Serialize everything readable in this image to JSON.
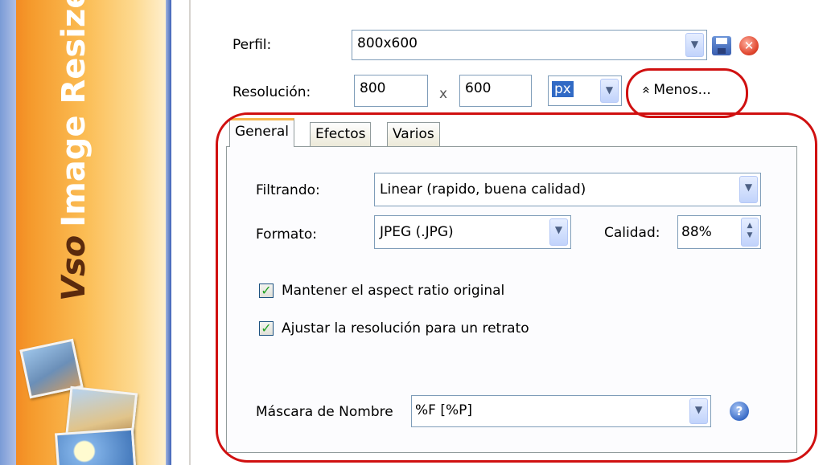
{
  "banner": {
    "logo_text": "Vso",
    "title": "Image Resizer"
  },
  "profile": {
    "label": "Perfil:",
    "value": "800x600",
    "save_icon": "save-icon",
    "delete_icon": "delete-icon",
    "delete_glyph": "✕"
  },
  "resolution": {
    "label": "Resolución:",
    "width": "800",
    "separator": "x",
    "height": "600",
    "unit": "px"
  },
  "less_button": {
    "icon": "«",
    "label": "Menos..."
  },
  "tabs": [
    {
      "label": "General",
      "active": true
    },
    {
      "label": "Efectos",
      "active": false
    },
    {
      "label": "Varios",
      "active": false
    }
  ],
  "general": {
    "filter_label": "Filtrando:",
    "filter_value": "Linear  (rapido, buena calidad)",
    "format_label": "Formato:",
    "format_value": "JPEG (.JPG)",
    "quality_label": "Calidad:",
    "quality_value": "88%",
    "keep_aspect_label": "Mantener el aspect ratio original",
    "keep_aspect_checked": true,
    "portrait_label": "Ajustar la resolución para un retrato",
    "portrait_checked": true,
    "name_mask_label": "Máscara de Nombre",
    "name_mask_value": "%F [%P]",
    "help_glyph": "?"
  },
  "glyphs": {
    "dropdown": "▼",
    "spin_up": "▲",
    "spin_down": "▼",
    "check": "✓"
  },
  "colors": {
    "highlight_circle": "#d01010",
    "banner_orange": "#f59a2c",
    "active_tab_accent": "#f7b64c"
  }
}
